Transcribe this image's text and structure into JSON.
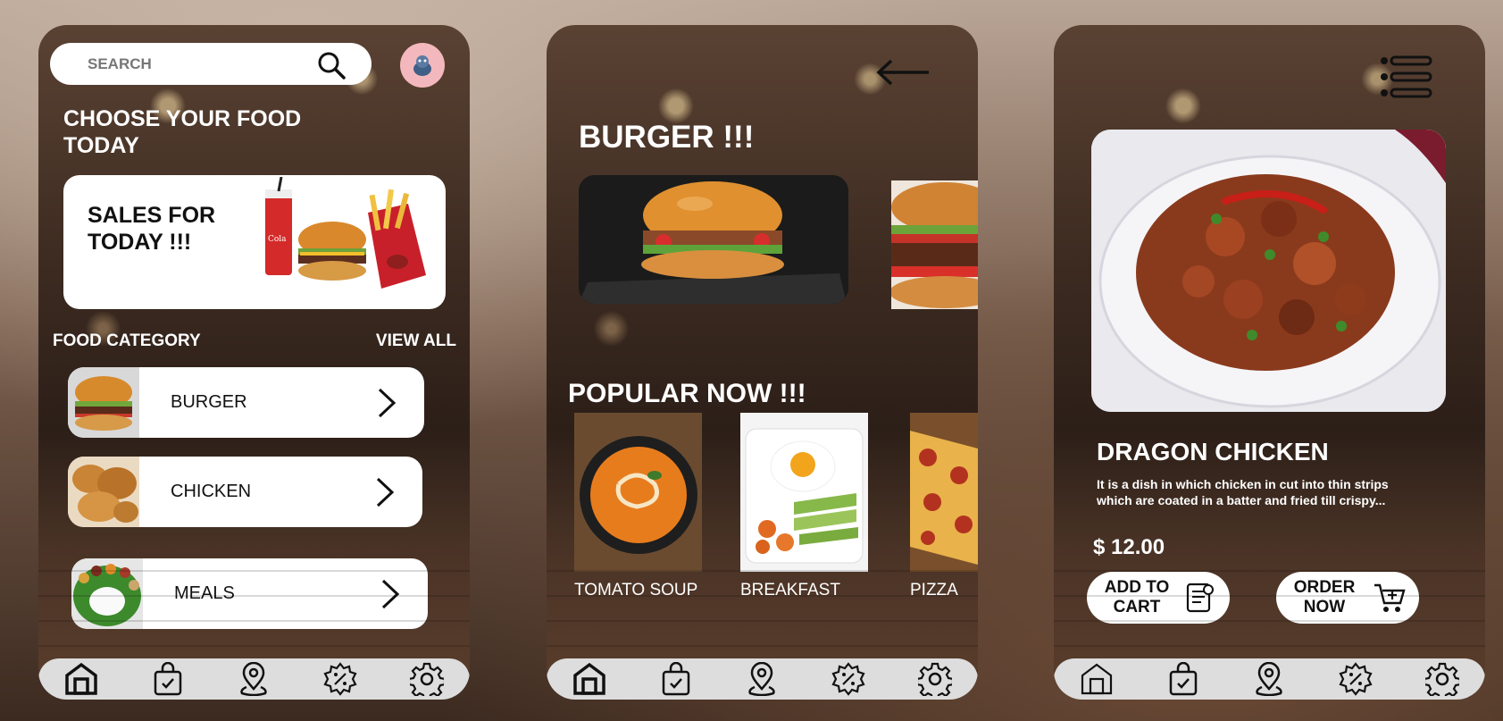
{
  "screen_home": {
    "search": {
      "placeholder": "SEARCH"
    },
    "headline": "CHOOSE YOUR FOOD TODAY",
    "sales_banner": {
      "title": "SALES FOR TODAY !!!"
    },
    "food_category": {
      "title": "FOOD CATEGORY",
      "view_all": "VIEW ALL"
    },
    "categories": [
      {
        "label": "BURGER"
      },
      {
        "label": "CHICKEN"
      },
      {
        "label": "MEALS"
      }
    ]
  },
  "screen_category": {
    "title": "BURGER !!!",
    "popular_title": "POPULAR NOW !!!",
    "popular": [
      {
        "label": "TOMATO SOUP"
      },
      {
        "label": "BREAKFAST"
      },
      {
        "label": "PIZZA"
      }
    ]
  },
  "screen_detail": {
    "name": "DRAGON CHICKEN",
    "description_line1": "It is a dish in which chicken in cut into thin strips",
    "description_line2": "which are  coated in a batter and fried till crispy...",
    "price": "$ 12.00",
    "add_to_cart": "ADD TO CART",
    "order_now": "ORDER NOW"
  },
  "nav": {
    "items": [
      {
        "icon": "home-icon"
      },
      {
        "icon": "shopping-bag-icon"
      },
      {
        "icon": "location-pin-icon"
      },
      {
        "icon": "discount-badge-icon"
      },
      {
        "icon": "settings-icon"
      }
    ]
  },
  "colors": {
    "card": "#ffffff",
    "navbar": "#dddddd",
    "avatar_bg": "#f3b8bd",
    "text_light": "#ffffff",
    "text_dark": "#111111"
  }
}
